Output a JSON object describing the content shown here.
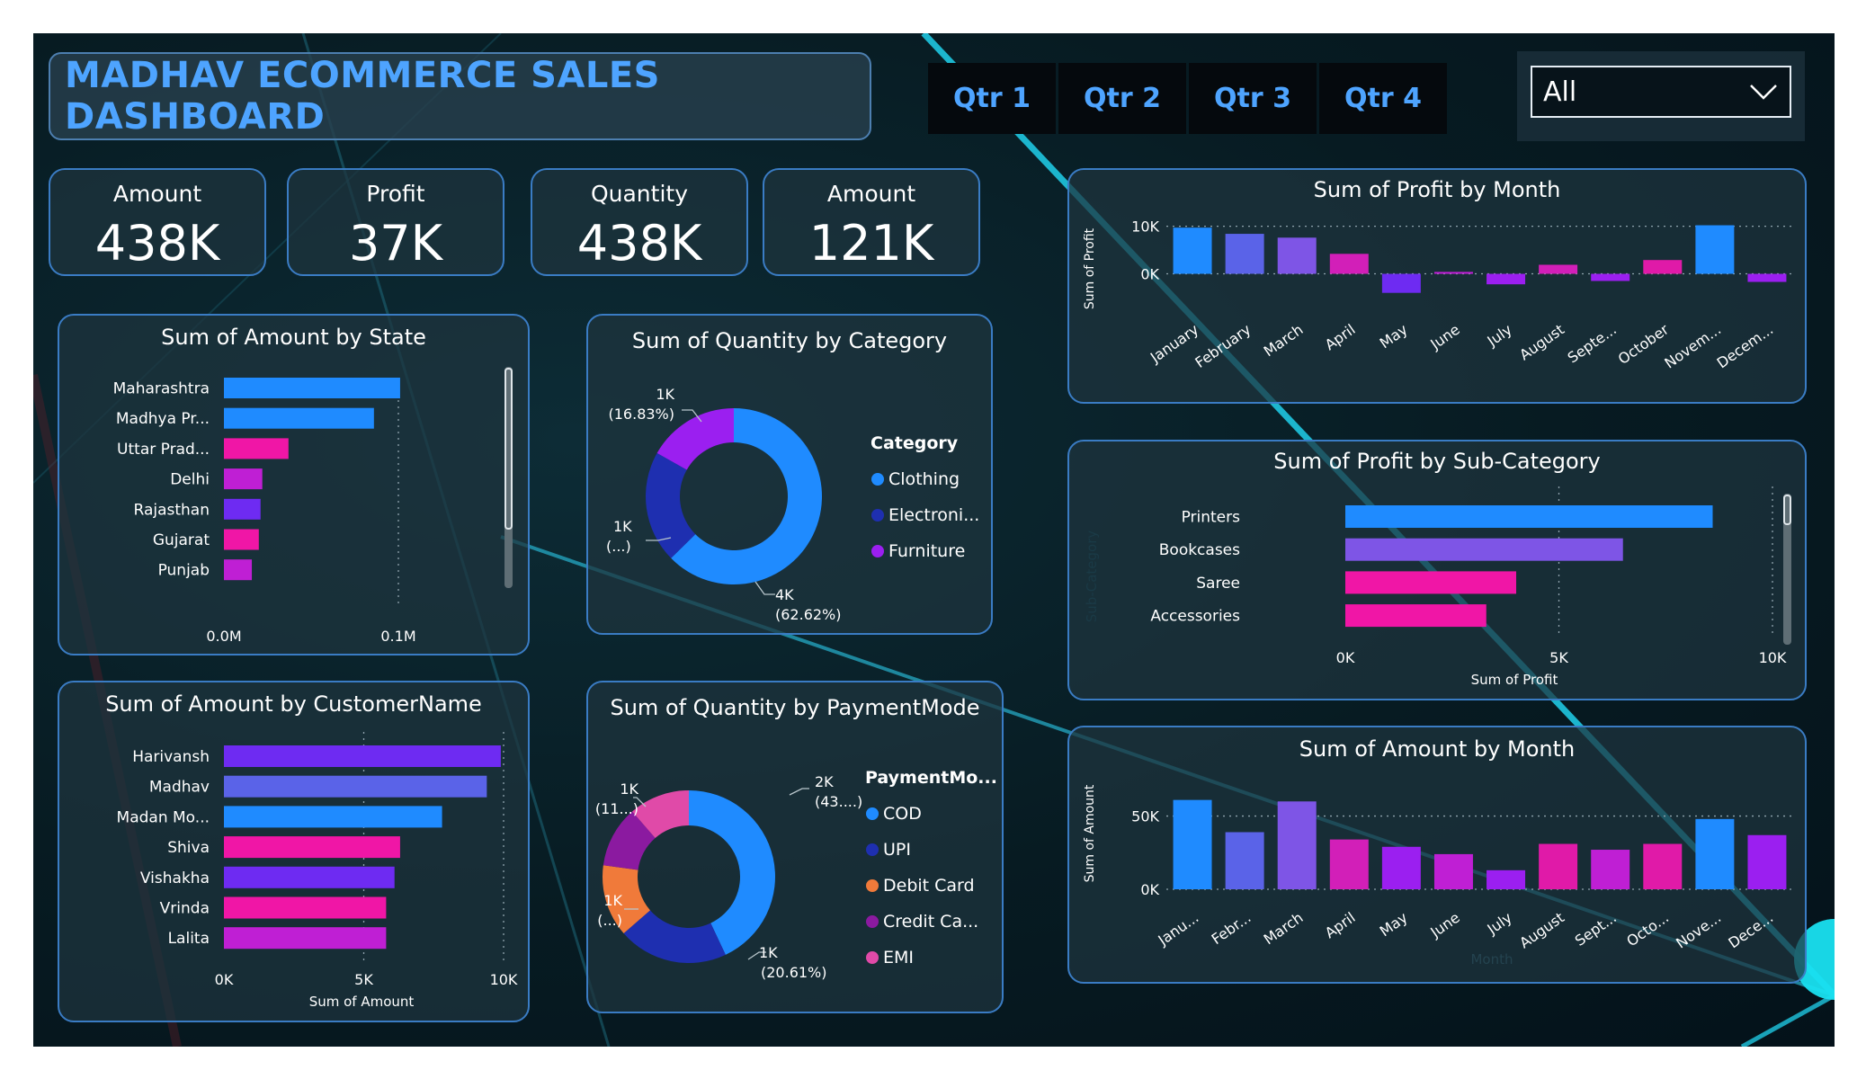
{
  "header": {
    "title": "MADHAV ECOMMERCE SALES DASHBOARD"
  },
  "quarters": [
    "Qtr 1",
    "Qtr 2",
    "Qtr 3",
    "Qtr 4"
  ],
  "slicer": {
    "value": "All"
  },
  "kpis": [
    {
      "label": "Amount",
      "value": "438K"
    },
    {
      "label": "Profit",
      "value": "37K"
    },
    {
      "label": "Quantity",
      "value": "438K"
    },
    {
      "label": "Amount",
      "value": "121K"
    }
  ],
  "colors": {
    "accent": "#4ea4ff",
    "panel_border": "#3a7cc4",
    "blue": "#1f8bff",
    "navy": "#1e2fb0",
    "purple": "#9b1ff0",
    "violet": "#6e2bf2",
    "pink": "#f016a6",
    "magenta": "#bf1fd4",
    "orange": "#f07a3a",
    "periwinkle": "#5a63e8",
    "lavender": "#7e55e6"
  },
  "chart_data": [
    {
      "type": "bar",
      "orientation": "horizontal",
      "title": "Sum of Amount by State",
      "categories": [
        "Maharashtra",
        "Madhya Pr...",
        "Uttar Prad...",
        "Delhi",
        "Rajasthan",
        "Gujarat",
        "Punjab"
      ],
      "values": [
        101000,
        86000,
        37000,
        22000,
        21000,
        20000,
        16000
      ],
      "bar_colors": [
        "#1f8bff",
        "#1f8bff",
        "#f016a6",
        "#bf1fd4",
        "#6e2bf2",
        "#f016a6",
        "#bf1fd4"
      ],
      "xlabel": "Sum of Amount",
      "ylabel": "",
      "xlim": [
        0,
        150000
      ],
      "ticks": [
        {
          "v": 0,
          "label": "0.0M"
        },
        {
          "v": 100000,
          "label": "0.1M"
        }
      ]
    },
    {
      "type": "pie",
      "donut": true,
      "title": "Sum of Quantity by Category",
      "legend_title": "Category",
      "labels": [
        "Clothing",
        "Electroni...",
        "Furniture"
      ],
      "values": [
        62.62,
        20.55,
        16.83
      ],
      "colors": [
        "#1f8bff",
        "#1e2fb0",
        "#9b1ff0"
      ],
      "data_labels": [
        [
          "4K",
          "(62.62%)"
        ],
        [
          "1K",
          "(...)"
        ],
        [
          "1K",
          "(16.83%)"
        ]
      ]
    },
    {
      "type": "bar",
      "title": "Sum of Profit by Month",
      "categories": [
        "January",
        "February",
        "March",
        "April",
        "May",
        "June",
        "July",
        "August",
        "Septe...",
        "October",
        "Novem...",
        "Decem..."
      ],
      "values": [
        9700,
        8400,
        7600,
        4200,
        -4000,
        400,
        -2200,
        1900,
        -1500,
        2900,
        10200,
        -1700
      ],
      "bar_colors": [
        "#1f8bff",
        "#5a63e8",
        "#7e55e6",
        "#d21fb8",
        "#6e2bf2",
        "#bf1fd4",
        "#9b1ff0",
        "#d21fb8",
        "#9b1ff0",
        "#e01aa8",
        "#1f8bff",
        "#9b1ff0"
      ],
      "ylabel": "Sum of Profit",
      "xlabel": "",
      "ylim": [
        -5000,
        12000
      ],
      "ticks": [
        {
          "v": 0,
          "label": "0K"
        },
        {
          "v": 10000,
          "label": "10K"
        }
      ]
    },
    {
      "type": "bar",
      "orientation": "horizontal",
      "title": "Sum of Profit by Sub-Category",
      "categories": [
        "Printers",
        "Bookcases",
        "Saree",
        "Accessories"
      ],
      "values": [
        8600,
        6500,
        4000,
        3300
      ],
      "bar_colors": [
        "#1f8bff",
        "#7e55e6",
        "#f016a6",
        "#f016a6"
      ],
      "xlabel": "Sum of Profit",
      "ylabel": "Sub-Category",
      "xlim": [
        0,
        10000
      ],
      "ticks": [
        {
          "v": 0,
          "label": "0K"
        },
        {
          "v": 5000,
          "label": "5K"
        },
        {
          "v": 10000,
          "label": "10K"
        }
      ]
    },
    {
      "type": "bar",
      "orientation": "horizontal",
      "title": "Sum of Amount by CustomerName",
      "categories": [
        "Harivansh",
        "Madhav",
        "Madan Mo...",
        "Shiva",
        "Vishakha",
        "Vrinda",
        "Lalita"
      ],
      "values": [
        9900,
        9400,
        7800,
        6300,
        6100,
        5800,
        5800
      ],
      "bar_colors": [
        "#6e2bf2",
        "#5a63e8",
        "#1f8bff",
        "#f016a6",
        "#6e2bf2",
        "#f016a6",
        "#bf1fd4"
      ],
      "xlabel": "Sum of Amount",
      "ylabel": "",
      "xlim": [
        0,
        10000
      ],
      "ticks": [
        {
          "v": 0,
          "label": "0K"
        },
        {
          "v": 5000,
          "label": "5K"
        },
        {
          "v": 10000,
          "label": "10K"
        }
      ]
    },
    {
      "type": "pie",
      "donut": true,
      "title": "Sum of Quantity by PaymentMode",
      "legend_title": "PaymentMo...",
      "labels": [
        "COD",
        "UPI",
        "Debit Card",
        "Credit Ca...",
        "EMI"
      ],
      "values": [
        43.0,
        20.61,
        13.5,
        11.5,
        11.39
      ],
      "colors": [
        "#1f8bff",
        "#1e2fb0",
        "#f07a3a",
        "#8b1aa0",
        "#e04aa8"
      ],
      "data_labels": [
        [
          "2K",
          "(43....)"
        ],
        [
          "1K",
          "(20.61%)"
        ],
        [
          "1K",
          "(...)"
        ],
        [
          "1K",
          "(11...)"
        ]
      ]
    },
    {
      "type": "bar",
      "title": "Sum of Amount by Month",
      "categories": [
        "Janu...",
        "Febr...",
        "March",
        "April",
        "May",
        "June",
        "July",
        "August",
        "Sept...",
        "Octo...",
        "Nove...",
        "Dece..."
      ],
      "values": [
        61000,
        39000,
        60000,
        34000,
        29000,
        24000,
        13000,
        31000,
        27000,
        31000,
        48000,
        37000
      ],
      "bar_colors": [
        "#1f8bff",
        "#5a63e8",
        "#7e55e6",
        "#d21fb8",
        "#9b1ff0",
        "#bf1fd4",
        "#9b1ff0",
        "#e01aa8",
        "#bf1fd4",
        "#e01aa8",
        "#1f8bff",
        "#9b1ff0"
      ],
      "ylabel": "Sum of Amount",
      "xlabel": "Month",
      "ylim": [
        0,
        70000
      ],
      "ticks": [
        {
          "v": 0,
          "label": "0K"
        },
        {
          "v": 50000,
          "label": "50K"
        }
      ]
    }
  ]
}
